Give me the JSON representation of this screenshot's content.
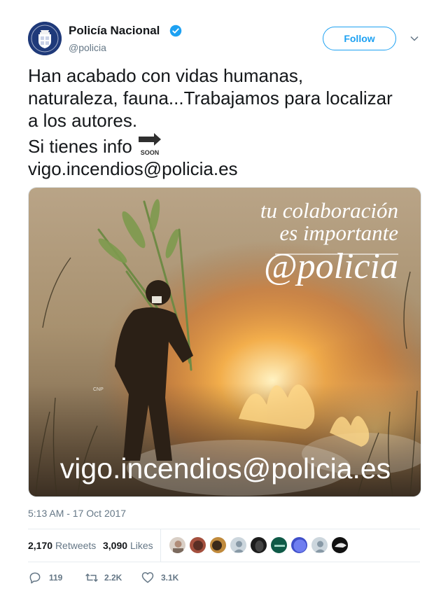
{
  "author": {
    "display_name": "Policía Nacional",
    "handle": "@policia",
    "verified": true,
    "avatar_icon": "police-badge-icon"
  },
  "header": {
    "follow_label": "Follow"
  },
  "tweet": {
    "lines": [
      "Han acabado con vidas humanas,",
      "naturaleza, fauna...Trabajamos para localizar",
      "a los autores.",
      "Si tienes info",
      "vigo.incendios@policia.es"
    ],
    "emoji": "soon-arrow-emoji",
    "emoji_text": "SOON"
  },
  "media": {
    "overlay_line1": "tu colaboración",
    "overlay_line2": "es importante",
    "overlay_handle": "@policia",
    "overlay_email": "vigo.incendios@policia.es",
    "badge_text": "CNP"
  },
  "meta": {
    "timestamp": "5:13 AM - 17 Oct 2017"
  },
  "stats": {
    "retweets_count": "2,170",
    "retweets_label": "Retweets",
    "likes_count": "3,090",
    "likes_label": "Likes"
  },
  "actions": {
    "replies": "119",
    "retweets": "2.2K",
    "likes": "3.1K"
  },
  "colors": {
    "accent": "#1da1f2",
    "secondary_text": "#657786",
    "avatar_bg": "#1d2f6e"
  }
}
